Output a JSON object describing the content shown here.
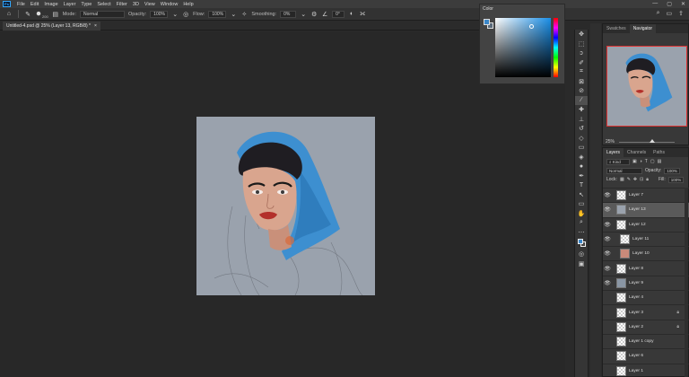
{
  "menubar": {
    "logo": "Ps",
    "items": [
      "File",
      "Edit",
      "Image",
      "Layer",
      "Type",
      "Select",
      "Filter",
      "3D",
      "View",
      "Window",
      "Help"
    ],
    "window_controls": [
      "—",
      "▢",
      "✕"
    ]
  },
  "options": {
    "brush_size": "200",
    "mode_label": "Mode:",
    "mode_value": "Normal",
    "opacity_label": "Opacity:",
    "opacity_value": "100%",
    "flow_label": "Flow:",
    "flow_value": "100%",
    "smoothing_label": "Smoothing:",
    "smoothing_value": "0%",
    "angle_value": "0°"
  },
  "document": {
    "tab_title": "Untitled-4.psd @ 25% (Layer 13, RGB/8) *",
    "close": "×"
  },
  "color_panel": {
    "title": "Color",
    "foreground": "#3a86c8"
  },
  "navigator": {
    "tabs": [
      "Swatches",
      "Navigator"
    ],
    "zoom": "25%"
  },
  "layers": {
    "tabs": [
      "Layers",
      "Channels",
      "Paths"
    ],
    "filter_label": "Kind",
    "blend_mode": "Normal",
    "opacity_label": "Opacity:",
    "opacity_value": "100%",
    "lock_label": "Lock:",
    "fill_label": "Fill:",
    "fill_value": "100%",
    "items": [
      {
        "name": "Layer 7",
        "selected": false,
        "locked": false,
        "indent": false
      },
      {
        "name": "Layer 13",
        "selected": true,
        "locked": false,
        "indent": false
      },
      {
        "name": "Layer 12",
        "selected": false,
        "locked": false,
        "indent": false
      },
      {
        "name": "Layer 11",
        "selected": false,
        "locked": false,
        "indent": true
      },
      {
        "name": "Layer 10",
        "selected": false,
        "locked": false,
        "indent": true
      },
      {
        "name": "Layer 8",
        "selected": false,
        "locked": false,
        "indent": false
      },
      {
        "name": "Layer 9",
        "selected": false,
        "locked": false,
        "indent": false
      },
      {
        "name": "Layer 4",
        "selected": false,
        "locked": false,
        "indent": false
      },
      {
        "name": "Layer 3",
        "selected": false,
        "locked": true,
        "indent": false
      },
      {
        "name": "Layer 2",
        "selected": false,
        "locked": true,
        "indent": false
      },
      {
        "name": "Layer 1 copy",
        "selected": false,
        "locked": false,
        "indent": false
      },
      {
        "name": "Layer 6",
        "selected": false,
        "locked": false,
        "indent": false
      },
      {
        "name": "Layer 1",
        "selected": false,
        "locked": false,
        "indent": false
      }
    ]
  }
}
